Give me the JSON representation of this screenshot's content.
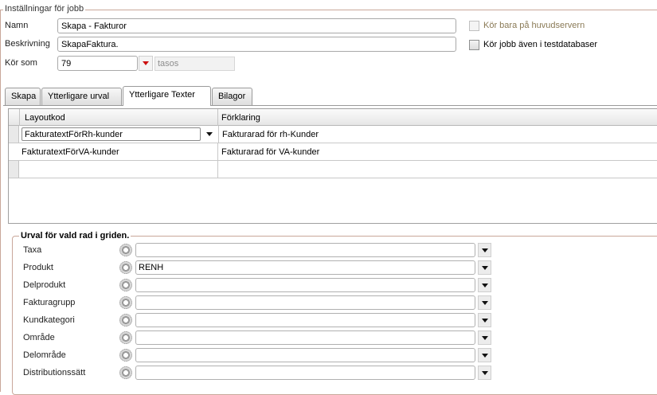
{
  "group_title": "Inställningar för jobb",
  "fields": {
    "name_label": "Namn",
    "name_value": "Skapa - Fakturor",
    "description_label": "Beskrivning",
    "description_value": "SkapaFaktura.",
    "run_as_label": "Kör som",
    "run_as_value": "79",
    "run_as_user": "tasos"
  },
  "checkboxes": {
    "main_server_only": "Kör bara på huvudservern",
    "test_database": "Kör jobb även i testdatabaser"
  },
  "tabs": [
    {
      "label": "Skapa"
    },
    {
      "label": "Ytterligare urval"
    },
    {
      "label": "Ytterligare Texter"
    },
    {
      "label": "Bilagor"
    }
  ],
  "active_tab": "Ytterligare Texter",
  "grid": {
    "columns": [
      "Layoutkod",
      "Förklaring"
    ],
    "rows": [
      {
        "layoutkod": "FakturatextFörRh-kunder",
        "forklaring": "Fakturarad för rh-Kunder"
      },
      {
        "layoutkod": "FakturatextFörVA-kunder",
        "forklaring": "Fakturarad för VA-kunder"
      }
    ]
  },
  "selection": {
    "title": "Urval för vald rad i griden.",
    "rows": [
      {
        "label": "Taxa",
        "value": ""
      },
      {
        "label": "Produkt",
        "value": "RENH"
      },
      {
        "label": "Delprodukt",
        "value": ""
      },
      {
        "label": "Fakturagrupp",
        "value": ""
      },
      {
        "label": "Kundkategori",
        "value": ""
      },
      {
        "label": "Område",
        "value": ""
      },
      {
        "label": "Delområde",
        "value": ""
      },
      {
        "label": "Distributionssätt",
        "value": ""
      }
    ]
  },
  "colors": {
    "frame_border": "#c9a79a",
    "dropdown_arrow_red": "#cc1010",
    "disabled_label": "#8a7a56"
  }
}
